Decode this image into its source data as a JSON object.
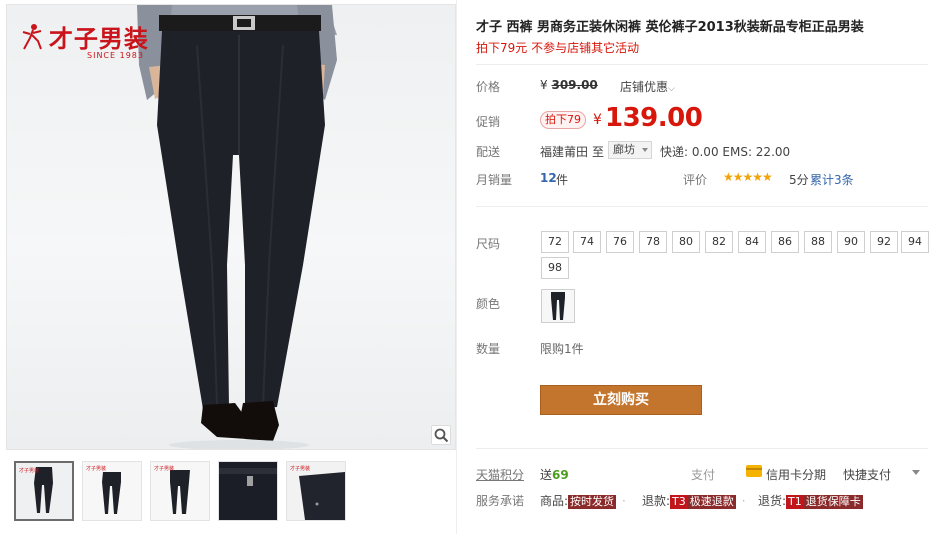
{
  "brand": {
    "logo_text": "才子男装",
    "since": "SINCE 1983"
  },
  "product": {
    "title": "才子 西裤 男商务正装休闲裤 英伦裤子2013秋装新品专柜正品男装",
    "subtitle": "拍下79元 不参与店铺其它活动"
  },
  "price": {
    "label": "价格",
    "currency": "¥",
    "original": "309.00",
    "shop_discount": "店铺优惠"
  },
  "promo": {
    "label": "促销",
    "tag": "拍下79",
    "currency": "¥",
    "price": "139.00"
  },
  "shipping": {
    "label": "配送",
    "from": "福建莆田",
    "to_label": "至",
    "to": "廊坊",
    "fee": "快递: 0.00 EMS: 22.00"
  },
  "sales": {
    "label": "月销量",
    "count": "12",
    "unit": "件",
    "rating_label": "评价",
    "stars": "★★★★★",
    "score": "5分",
    "reviews": "累计3条"
  },
  "sizes": {
    "label": "尺码",
    "options": [
      "72",
      "74",
      "76",
      "78",
      "80",
      "82",
      "84",
      "86",
      "88",
      "90",
      "92",
      "94",
      "98"
    ]
  },
  "color": {
    "label": "颜色"
  },
  "quantity": {
    "label": "数量",
    "limit": "限购1件"
  },
  "buy_button": "立刻购买",
  "tmall": {
    "points_label": "天猫积分",
    "send_prefix": "送",
    "points": "69",
    "pay_label": "支付",
    "credit_card": "信用卡分期",
    "quick_pay": "快捷支付"
  },
  "services": {
    "label": "服务承诺",
    "items": [
      {
        "prefix": "商品:",
        "badge": "按时发货"
      },
      {
        "prefix": "退款:",
        "code": "T3",
        "badge": "极速退款"
      },
      {
        "prefix": "退货:",
        "code": "T1",
        "badge": "退货保障卡"
      }
    ]
  },
  "colors": {
    "price_red": "#d7170b",
    "buy_orange": "#c4752d",
    "link_blue": "#3366aa",
    "brand_red": "#c9141b"
  }
}
